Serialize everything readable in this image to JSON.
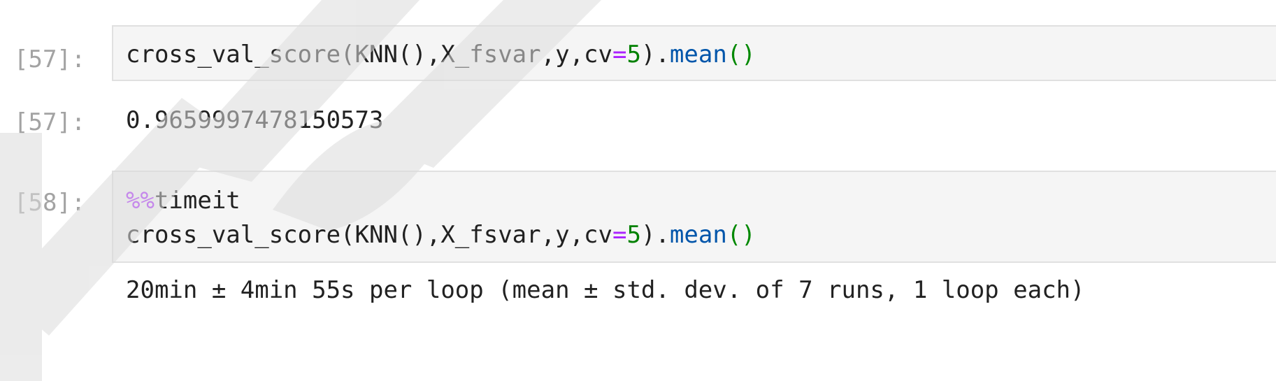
{
  "cells": [
    {
      "prompt": "[57]:",
      "code": {
        "fn": "cross_val_score(KNN(),X_fsvar,y,cv",
        "eq": "=",
        "num": "5",
        "close": ").",
        "method": "mean",
        "parens": "()"
      },
      "output_prompt": "[57]:",
      "output": "0.9659997478150573"
    },
    {
      "prompt": "[58]:",
      "magic_prefix": "%%",
      "magic_name": "timeit",
      "code": {
        "fn": "cross_val_score(KNN(),X_fsvar,y,cv",
        "eq": "=",
        "num": "5",
        "close": ").",
        "method": "mean",
        "parens": "()"
      },
      "output": "20min ± 4min 55s per loop (mean ± std. dev. of 7 runs, 1 loop each)"
    }
  ],
  "colors": {
    "prompt": "#a3a3a3",
    "cell_bg": "#f5f5f5",
    "operator": "#aa22ff",
    "number": "#008000",
    "method": "#0055aa"
  }
}
